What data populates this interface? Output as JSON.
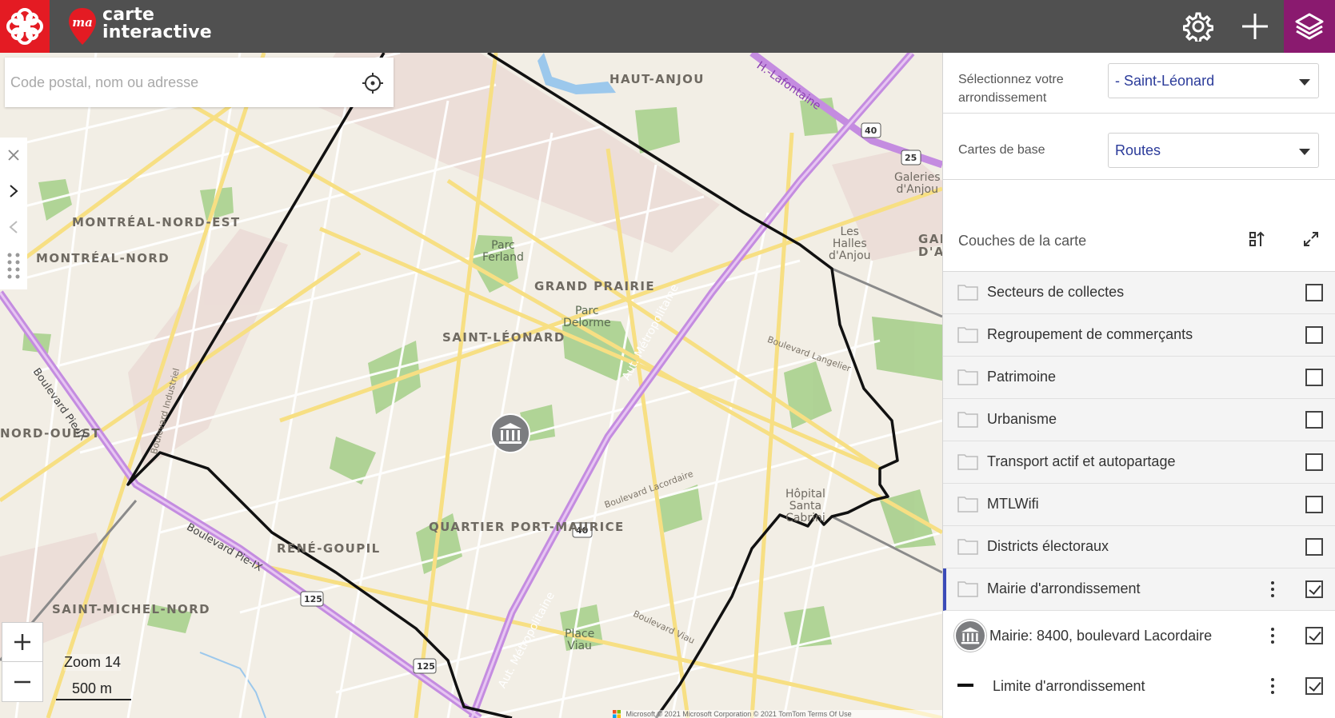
{
  "header": {
    "app_logo_text": "ma",
    "app_title_line1": "carte",
    "app_title_line2": "interactive",
    "settings_icon": "gear-icon",
    "add_icon": "plus-icon",
    "layers_icon": "layers-icon",
    "layers_active_color": "#8a1a6f"
  },
  "search": {
    "placeholder": "Code postal, nom ou adresse",
    "value": ""
  },
  "map": {
    "labels": {
      "haut_anjou": "HAUT-ANJOU",
      "montreal_nord_est": "MONTRÉAL-NORD-EST",
      "montreal_nord": "MONTRÉAL-NORD",
      "grand_prairie": "GRAND PRAIRIE",
      "saint_leonard": "SAINT-LÉONARD",
      "nord_ouest": "NORD-OUEST",
      "quartier_port_maurice": "QUARTIER PORT-MAURICE",
      "rene_goupil": "RENÉ-GOUPIL",
      "saint_michel_nord": "SAINT-MICHEL-NORD",
      "parc_ferland_1": "Parc",
      "parc_ferland_2": "Ferland",
      "parc_delorme_1": "Parc",
      "parc_delorme_2": "Delorme",
      "place_viau_1": "Place",
      "place_viau_2": "Viau",
      "galeries_1": "Galeries",
      "galeries_2": "d'Anjou",
      "halles_1": "Les",
      "halles_2": "Halles",
      "halles_3": "d'Anjou",
      "hopital_1": "Hôpital",
      "hopital_2": "Santa",
      "hopital_3": "Cabrini",
      "gal": "GAL",
      "da": "D'A",
      "aut_metropolitaine": "Aut. Métropolitaine",
      "aut_metropolitaine_2": "Aut. Métropolitaine",
      "blvd_pie_ix": "Boulevard Pie-IX",
      "blvd_pie_ix_2": "Boulevard Pie-IX",
      "blvd_langelier": "Boulevard Langelier",
      "blvd_lacordaire": "Boulevard Lacordaire",
      "blvd_viau": "Boulevard Viau",
      "blvd_industriel": "Boulevard Industriel",
      "h_lafontaine": "H.-Lafontaine",
      "route_40_a": "40",
      "route_40_b": "40",
      "route_25": "25",
      "route_125_a": "125",
      "route_125_b": "125"
    },
    "zoom_label": "Zoom 14",
    "scale_label": "500 m",
    "attribution": "© 2021 Microsoft Corporation © 2021 TomTom Terms Of Use",
    "attribution_brand": "Microsoft",
    "marker_icon": "city-hall-icon"
  },
  "panel": {
    "borough_label": "Sélectionnez votre arrondissement",
    "borough_value": "- Saint-Léonard",
    "basemap_label": "Cartes de base",
    "basemap_value": "Routes",
    "layers_title": "Couches de la carte",
    "layers": [
      {
        "label": "Secteurs de collectes",
        "checked": false
      },
      {
        "label": "Regroupement de commerçants",
        "checked": false
      },
      {
        "label": "Patrimoine",
        "checked": false
      },
      {
        "label": "Urbanisme",
        "checked": false
      },
      {
        "label": "Transport actif et autopartage",
        "checked": false
      },
      {
        "label": "MTLWifi",
        "checked": false
      },
      {
        "label": "Districts électoraux",
        "checked": false
      },
      {
        "label": "Mairie d'arrondissement",
        "checked": true
      }
    ],
    "sublayers": [
      {
        "label": "Mairie: 8400, boulevard Lacordaire",
        "checked": true
      },
      {
        "label": "Limite d'arrondissement",
        "checked": true
      }
    ],
    "accent_color": "#3b4bb8"
  }
}
